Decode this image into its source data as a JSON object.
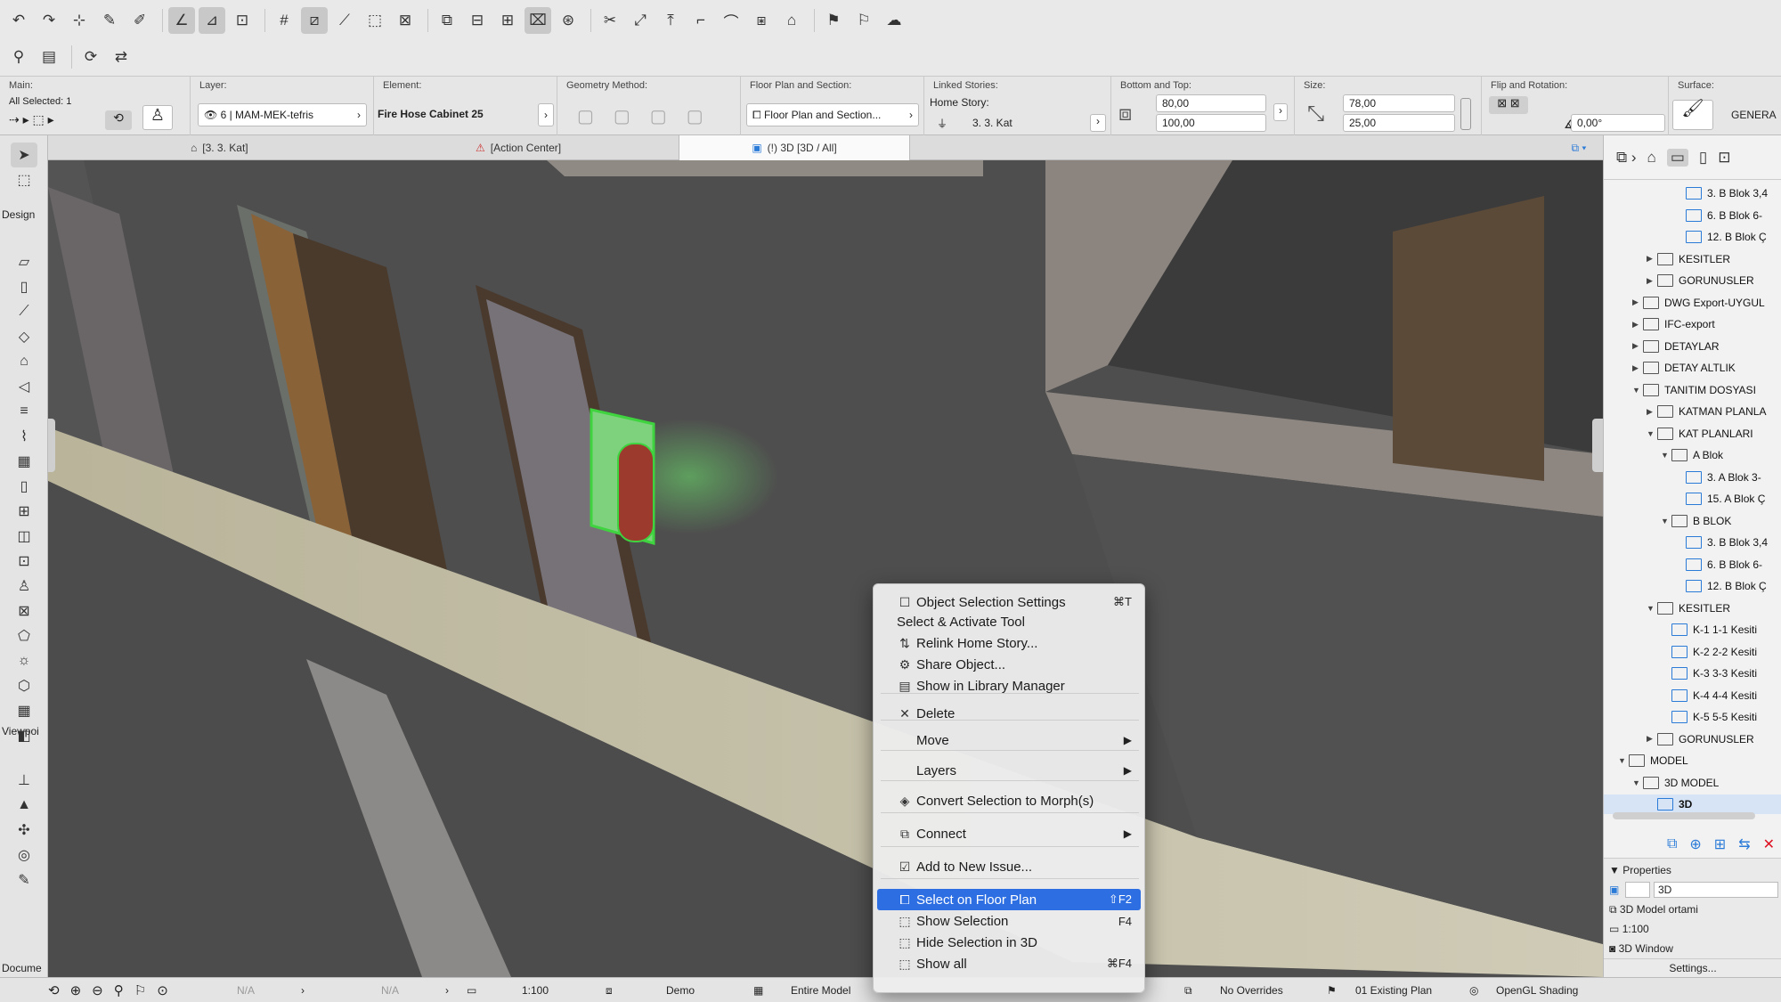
{
  "toolbar": {
    "row1_icons": [
      "undo-icon",
      "redo-icon",
      "select-fill-icon",
      "eyedropper-icon",
      "syringe-icon",
      "guide-icon",
      "snap-guide-icon",
      "snap-grid-icon",
      "grid-icon",
      "trace-icon",
      "relative-construction-icon",
      "cursor-snap-icon",
      "suspend-groups-icon",
      "layer-combo-icon",
      "dimension-icon",
      "measure-icon",
      "marquee-icon",
      "gravity-icon",
      "scissors-icon",
      "adjust-icon",
      "elevate-icon",
      "offset-icon",
      "fillet-icon",
      "crop-icon",
      "roof-icon",
      "flag-icon",
      "renovation-icon",
      "cloud-icon"
    ],
    "row2_icons": [
      "chair-icon",
      "palette-icon",
      "teamwork-icon",
      "send-receive-icon"
    ]
  },
  "infobox": {
    "main_title": "Main:",
    "all_selected": "All Selected: 1",
    "layer_title": "Layer:",
    "layer_value": "6 | MAM-MEK-tefris",
    "element_title": "Element:",
    "element_value": "Fire Hose Cabinet 25",
    "geometry_title": "Geometry Method:",
    "floorplan_title": "Floor Plan and Section:",
    "floorplan_value": "Floor Plan and Section...",
    "linked_title": "Linked Stories:",
    "home_story_label": "Home Story:",
    "home_story_value": "3. 3. Kat",
    "bottomtop_title": "Bottom and Top:",
    "bottom_value": "80,00",
    "top_value": "100,00",
    "size_title": "Size:",
    "size_a": "78,00",
    "size_b": "25,00",
    "flip_title": "Flip and Rotation:",
    "rotation_value": "0,00°",
    "surface_title": "Surface:",
    "surface_value": "GENERA"
  },
  "tabs": [
    {
      "label": "[3. 3. Kat]"
    },
    {
      "label": "[Action Center]"
    },
    {
      "label": "(!) 3D [3D / All]"
    }
  ],
  "left_tools": {
    "design_label": "Design",
    "viewpoint_label": "Viewpoi",
    "document_label": "Docume"
  },
  "navigator": {
    "items": [
      {
        "label": "3. B Blok 3,4",
        "indent": 4,
        "tri": "",
        "type": "view"
      },
      {
        "label": "6. B Blok 6-",
        "indent": 4,
        "tri": "",
        "type": "view"
      },
      {
        "label": "12. B Blok Ç",
        "indent": 4,
        "tri": "",
        "type": "view"
      },
      {
        "label": "KESITLER",
        "indent": 2,
        "tri": "▶",
        "type": "folder"
      },
      {
        "label": "GORUNUSLER",
        "indent": 2,
        "tri": "▶",
        "type": "folder"
      },
      {
        "label": "DWG Export-UYGUL",
        "indent": 1,
        "tri": "▶",
        "type": "folder"
      },
      {
        "label": "IFC-export",
        "indent": 1,
        "tri": "▶",
        "type": "folder"
      },
      {
        "label": "DETAYLAR",
        "indent": 1,
        "tri": "▶",
        "type": "folder"
      },
      {
        "label": "DETAY ALTLIK",
        "indent": 1,
        "tri": "▶",
        "type": "folder"
      },
      {
        "label": "TANITIM DOSYASI",
        "indent": 1,
        "tri": "▼",
        "type": "folder"
      },
      {
        "label": "KATMAN PLANLA",
        "indent": 2,
        "tri": "▶",
        "type": "folder"
      },
      {
        "label": "KAT PLANLARI",
        "indent": 2,
        "tri": "▼",
        "type": "folder"
      },
      {
        "label": "A Blok",
        "indent": 3,
        "tri": "▼",
        "type": "folder"
      },
      {
        "label": "3. A Blok 3-",
        "indent": 4,
        "tri": "",
        "type": "view"
      },
      {
        "label": "15. A Blok Ç",
        "indent": 4,
        "tri": "",
        "type": "view"
      },
      {
        "label": "B BLOK",
        "indent": 3,
        "tri": "▼",
        "type": "folder"
      },
      {
        "label": "3. B Blok 3,4",
        "indent": 4,
        "tri": "",
        "type": "view"
      },
      {
        "label": "6. B Blok 6-",
        "indent": 4,
        "tri": "",
        "type": "view"
      },
      {
        "label": "12. B Blok Ç",
        "indent": 4,
        "tri": "",
        "type": "view"
      },
      {
        "label": "KESITLER",
        "indent": 2,
        "tri": "▼",
        "type": "folder"
      },
      {
        "label": "K-1 1-1 Kesiti",
        "indent": 3,
        "tri": "",
        "type": "view"
      },
      {
        "label": "K-2 2-2 Kesiti",
        "indent": 3,
        "tri": "",
        "type": "view"
      },
      {
        "label": "K-3 3-3 Kesiti",
        "indent": 3,
        "tri": "",
        "type": "view"
      },
      {
        "label": "K-4 4-4 Kesiti",
        "indent": 3,
        "tri": "",
        "type": "view"
      },
      {
        "label": "K-5 5-5 Kesiti",
        "indent": 3,
        "tri": "",
        "type": "view"
      },
      {
        "label": "GORUNUSLER",
        "indent": 2,
        "tri": "▶",
        "type": "folder"
      },
      {
        "label": "MODEL",
        "indent": 0,
        "tri": "▼",
        "type": "folder"
      },
      {
        "label": "3D MODEL",
        "indent": 1,
        "tri": "▼",
        "type": "folder"
      },
      {
        "label": "3D",
        "indent": 2,
        "tri": "",
        "type": "view",
        "selected": true
      }
    ]
  },
  "properties": {
    "title": "Properties",
    "name_value": "3D",
    "model_view": "3D Model ortami",
    "scale": "1:100",
    "window": "3D Window",
    "settings_label": "Settings..."
  },
  "statusbar": {
    "na1": "N/A",
    "na2": "N/A",
    "scale": "1:100",
    "layer_combo": "Demo",
    "model": "Entire Model",
    "overrides": "No Overrides",
    "renovation": "01 Existing Plan",
    "shading": "OpenGL Shading"
  },
  "context_menu": {
    "items": [
      {
        "label": "Object Selection Settings",
        "icon": "☐",
        "shortcut": "⌘T"
      },
      {
        "label": "Select & Activate Tool",
        "icon": "",
        "shortcut": ""
      },
      {
        "label": "Relink Home Story...",
        "icon": "⇅",
        "shortcut": ""
      },
      {
        "label": "Share Object...",
        "icon": "⚙",
        "shortcut": ""
      },
      {
        "label": "Show in Library Manager",
        "icon": "▤",
        "shortcut": ""
      },
      {
        "label": "Delete",
        "icon": "✕",
        "shortcut": ""
      },
      {
        "label": "Move",
        "icon": "",
        "shortcut": "",
        "submenu": "▶"
      },
      {
        "label": "Layers",
        "icon": "",
        "shortcut": "",
        "submenu": "▶"
      },
      {
        "label": "Convert Selection to Morph(s)",
        "icon": "◈",
        "shortcut": ""
      },
      {
        "label": "Connect",
        "icon": "⧉",
        "shortcut": "",
        "submenu": "▶"
      },
      {
        "label": "Add to New Issue...",
        "icon": "☑",
        "shortcut": ""
      },
      {
        "label": "Select on Floor Plan",
        "icon": "⧠",
        "shortcut": "⇧F2",
        "highlighted": true
      },
      {
        "label": "Show Selection",
        "icon": "⬚",
        "shortcut": "F4"
      },
      {
        "label": "Hide Selection in 3D",
        "icon": "⬚",
        "shortcut": ""
      },
      {
        "label": "Show all",
        "icon": "⬚",
        "shortcut": "⌘F4"
      }
    ]
  }
}
